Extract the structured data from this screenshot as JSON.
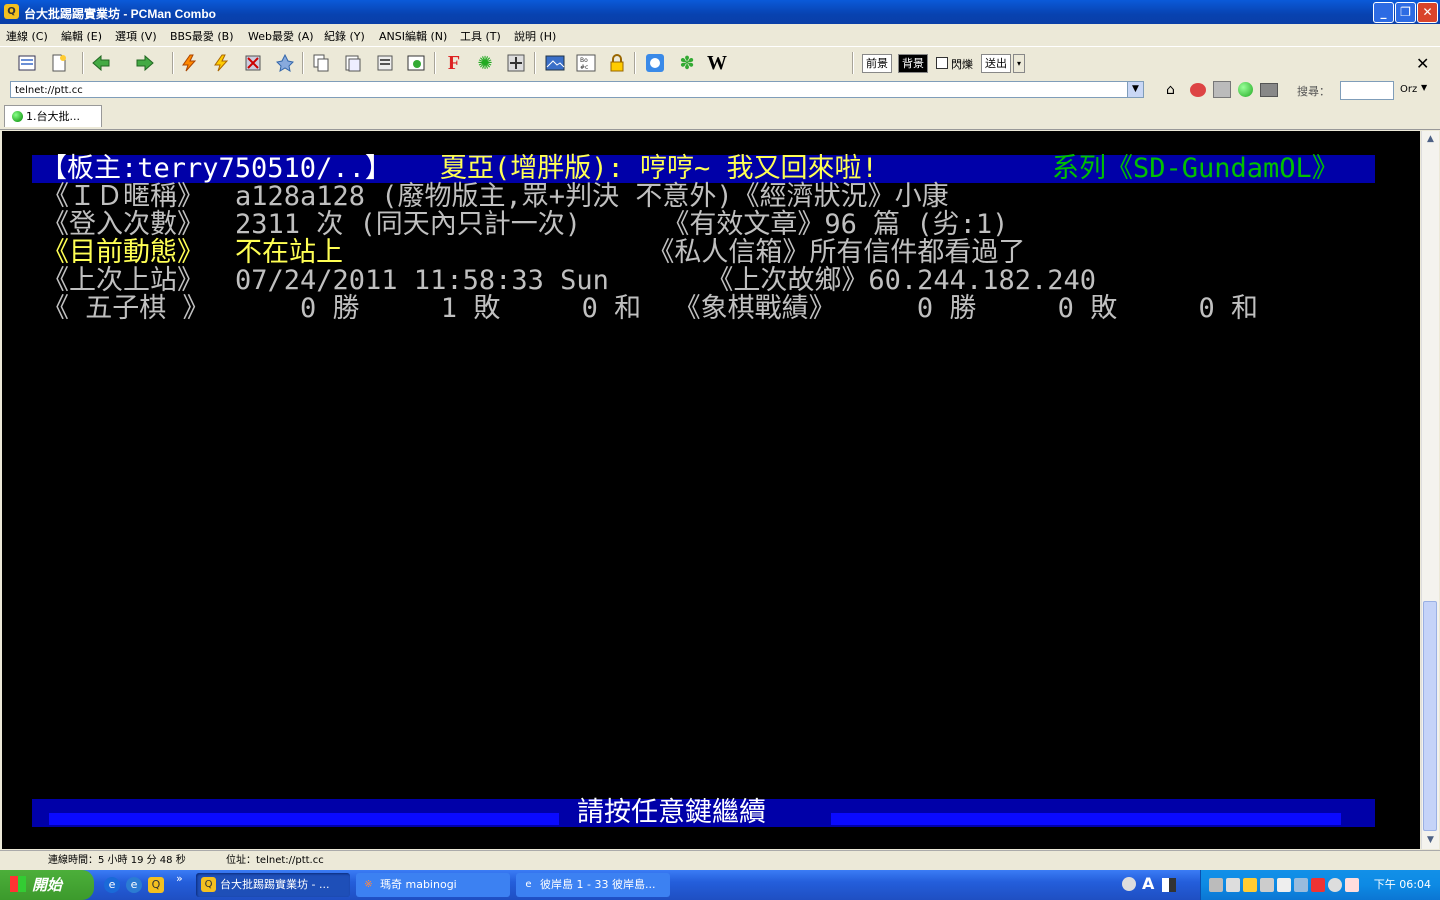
{
  "window": {
    "title": "台大批踢踢實業坊 - PCMan Combo",
    "app_icon": "Q",
    "buttons": [
      "_",
      "❐",
      "✕"
    ]
  },
  "menu": [
    "連線 (C)",
    "編輯 (E)",
    "選項 (V)",
    "BBS最愛 (B)",
    "Web最愛 (A)",
    "紀錄 (Y)",
    "ANSI編輯 (N)",
    "工具 (T)",
    "說明 (H)"
  ],
  "toolbar": {
    "icons": [
      "connect-list-icon",
      "new-page-icon",
      "back-icon",
      "forward-icon",
      "lightning-connect-icon",
      "lightning-reconnect-icon",
      "disconnect-icon",
      "pin-icon",
      "copy-icon",
      "paste-icon",
      "paste-special-icon",
      "screenshot-icon",
      "font-icon",
      "settings-icon",
      "fullscreen-icon",
      "image-icon",
      "ansi-icon",
      "lock-icon",
      "pcman-icon",
      "flower-icon",
      "wikipedia-icon"
    ],
    "fg_label": "前景",
    "bg_label": "背景",
    "blink_label": "閃爍",
    "send_label": "送出",
    "close_label": "✕"
  },
  "address": {
    "value": "telnet://ptt.cc",
    "search_label": "搜尋：",
    "search_engine": "Orz"
  },
  "tabs": [
    {
      "label": "1.台大批..."
    }
  ],
  "terminal": {
    "header": {
      "left": "【板主:terry750510/..】",
      "middle": "夏亞(增胖版): 哼哼~ 我又回來啦!",
      "right": "系列《SD-GundamOL》"
    },
    "rows": [
      {
        "a": "《ＩＤ暱稱》",
        "b": "a128a128 (廢物版主,眾+判決 不意外)《經濟狀況》小康"
      },
      {
        "a": "《登入次數》",
        "b": "2311 次 (同天內只計一次)     《有效文章》96 篇 (劣:1)"
      },
      {
        "a": "《目前動態》",
        "b": "不在站上",
        "c": "                 《私人信箱》所有信件都看過了"
      },
      {
        "a": "《上次上站》",
        "b": "07/24/2011 11:58:33 Sun      《上次故鄉》60.244.182.240"
      },
      {
        "a": "《 五子棋 》",
        "b": "    0 勝     1 敗     0 和  《象棋戰績》     0 勝     0 敗     0 和"
      }
    ],
    "footer": "請按任意鍵繼續"
  },
  "statusbar": {
    "time": "連線時間：5 小時 19 分 48 秒",
    "addr": "位址：telnet://ptt.cc"
  },
  "taskbar": {
    "start_label": "開始",
    "quick_more": "»",
    "tasks": [
      {
        "label": "台大批踢踢實業坊 - ...",
        "icon": "Q"
      },
      {
        "label": "瑪奇 mabinogi",
        "icon": "※"
      },
      {
        "label": "彼岸島 1 - 33 彼岸島...",
        "icon": "e"
      }
    ],
    "ime": "A",
    "clock": "下午 06:04"
  },
  "colors": {
    "terminal_bg": "#000000",
    "terminal_bar": "#0000a8",
    "yellow": "#ffff54",
    "green": "#00c000"
  }
}
